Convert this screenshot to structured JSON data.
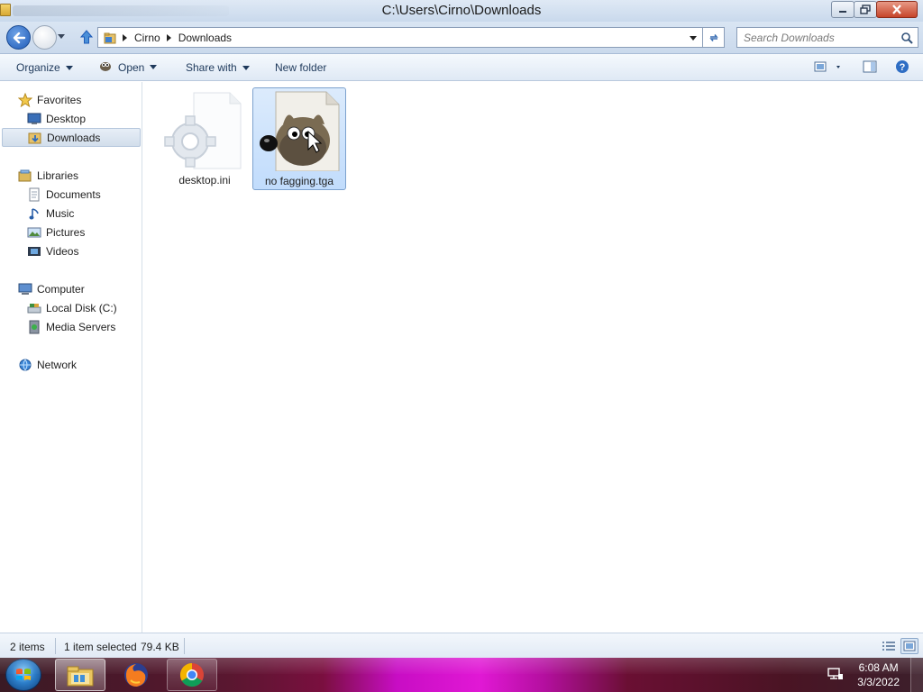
{
  "window": {
    "title": "C:\\Users\\Cirno\\Downloads",
    "background_title_blur": ""
  },
  "address": {
    "crumbs": [
      "Cirno",
      "Downloads"
    ]
  },
  "search": {
    "placeholder": "Search Downloads"
  },
  "commands": {
    "organize": "Organize",
    "open": "Open",
    "share_with": "Share with",
    "new_folder": "New folder"
  },
  "nav": {
    "favorites": "Favorites",
    "desktop": "Desktop",
    "downloads": "Downloads",
    "libraries": "Libraries",
    "documents": "Documents",
    "music": "Music",
    "pictures": "Pictures",
    "videos": "Videos",
    "computer": "Computer",
    "local_disk": "Local Disk (C:)",
    "media_servers": "Media Servers",
    "network": "Network"
  },
  "files": [
    {
      "name": "desktop.ini",
      "icon": "settings-file-icon",
      "selected": false
    },
    {
      "name": "no fagging.tga",
      "icon": "gimp-image-icon",
      "selected": true
    }
  ],
  "status": {
    "item_count": "2 items",
    "selection": "1 item selected",
    "size": "79.4 KB"
  },
  "taskbar": {
    "time": "6:08 AM",
    "date": "3/3/2022",
    "apps": [
      "file-explorer-icon",
      "firefox-icon",
      "chrome-icon"
    ]
  },
  "colors": {
    "accent": "#1e5bb8",
    "command_text": "#1e395b",
    "selection": "#c1dcfc",
    "taskbar_highlight": "#e118d5"
  }
}
